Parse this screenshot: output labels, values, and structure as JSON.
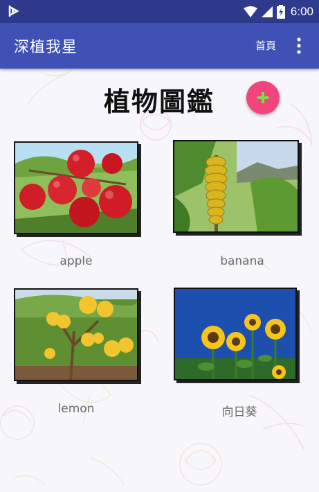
{
  "status_bar": {
    "time": "6:00",
    "icons": [
      "notification-icon",
      "wifi-icon",
      "signal-icon",
      "battery-charging-icon"
    ]
  },
  "app_bar": {
    "title": "深植我星",
    "home_label": "首頁",
    "overflow_icon": "more-vert-icon"
  },
  "page": {
    "title": "植物圖鑑",
    "add_icon": "plus-icon"
  },
  "plants": [
    {
      "label": "apple"
    },
    {
      "label": "banana"
    },
    {
      "label": "lemon"
    },
    {
      "label": "向日葵"
    }
  ],
  "colors": {
    "status_bar": "#2e3a8c",
    "app_bar": "#3f51b5",
    "fab": "#f0467d",
    "fab_plus": "#7ddc4a"
  }
}
